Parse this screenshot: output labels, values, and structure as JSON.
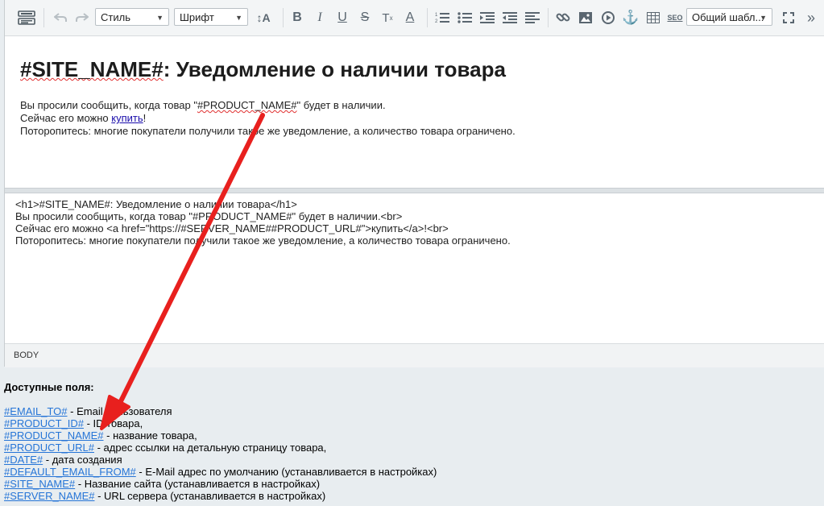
{
  "toolbar": {
    "style_select": "Стиль",
    "font_select": "Шрифт",
    "template_select": "Общий шабл...",
    "seo_label": "SEO"
  },
  "visual": {
    "heading_part1": "#SITE_NAME#",
    "heading_part2": ": Уведомление о наличии товара",
    "line1_prefix": "Вы просили сообщить, когда товар \"",
    "line1_tag": "#PRODUCT_NAME#",
    "line1_suffix": "\" будет в наличии.",
    "line2_prefix": "Сейчас его можно ",
    "line2_link": "купить",
    "line2_suffix": "!",
    "line3": "Поторопитесь: многие покупатели получили такое же уведомление, а количество товара ограничено."
  },
  "source": {
    "lines": [
      "<h1>#SITE_NAME#: Уведомление о наличии товара</h1>",
      "Вы просили сообщить, когда товар \"#PRODUCT_NAME#\" будет в наличии.<br>",
      "Сейчас его можно <a href=\"https://#SERVER_NAME##PRODUCT_URL#\">купить</a>!<br>",
      "Поторопитесь: многие покупатели получили такое же уведомление, а количество товара ограничено."
    ]
  },
  "pathbar": {
    "label": "BODY"
  },
  "fields": {
    "title": "Доступные поля:",
    "items": [
      {
        "tag": "#EMAIL_TO#",
        "desc": " - Email пользователя"
      },
      {
        "tag": "#PRODUCT_ID#",
        "desc": " - ID товара,"
      },
      {
        "tag": "#PRODUCT_NAME#",
        "desc": " - название товара,"
      },
      {
        "tag": "#PRODUCT_URL#",
        "desc": " - адрес ссылки на детальную страницу товара,"
      },
      {
        "tag": "#DATE#",
        "desc": " - дата создания"
      },
      {
        "tag": "#DEFAULT_EMAIL_FROM#",
        "desc": " - E-Mail адрес по умолчанию (устанавливается в настройках)"
      },
      {
        "tag": "#SITE_NAME#",
        "desc": " - Название сайта (устанавливается в настройках)"
      },
      {
        "tag": "#SERVER_NAME#",
        "desc": " - URL сервера (устанавливается в настройках)"
      }
    ]
  },
  "colors": {
    "arrow": "#e8201e",
    "link": "#2675d7"
  }
}
